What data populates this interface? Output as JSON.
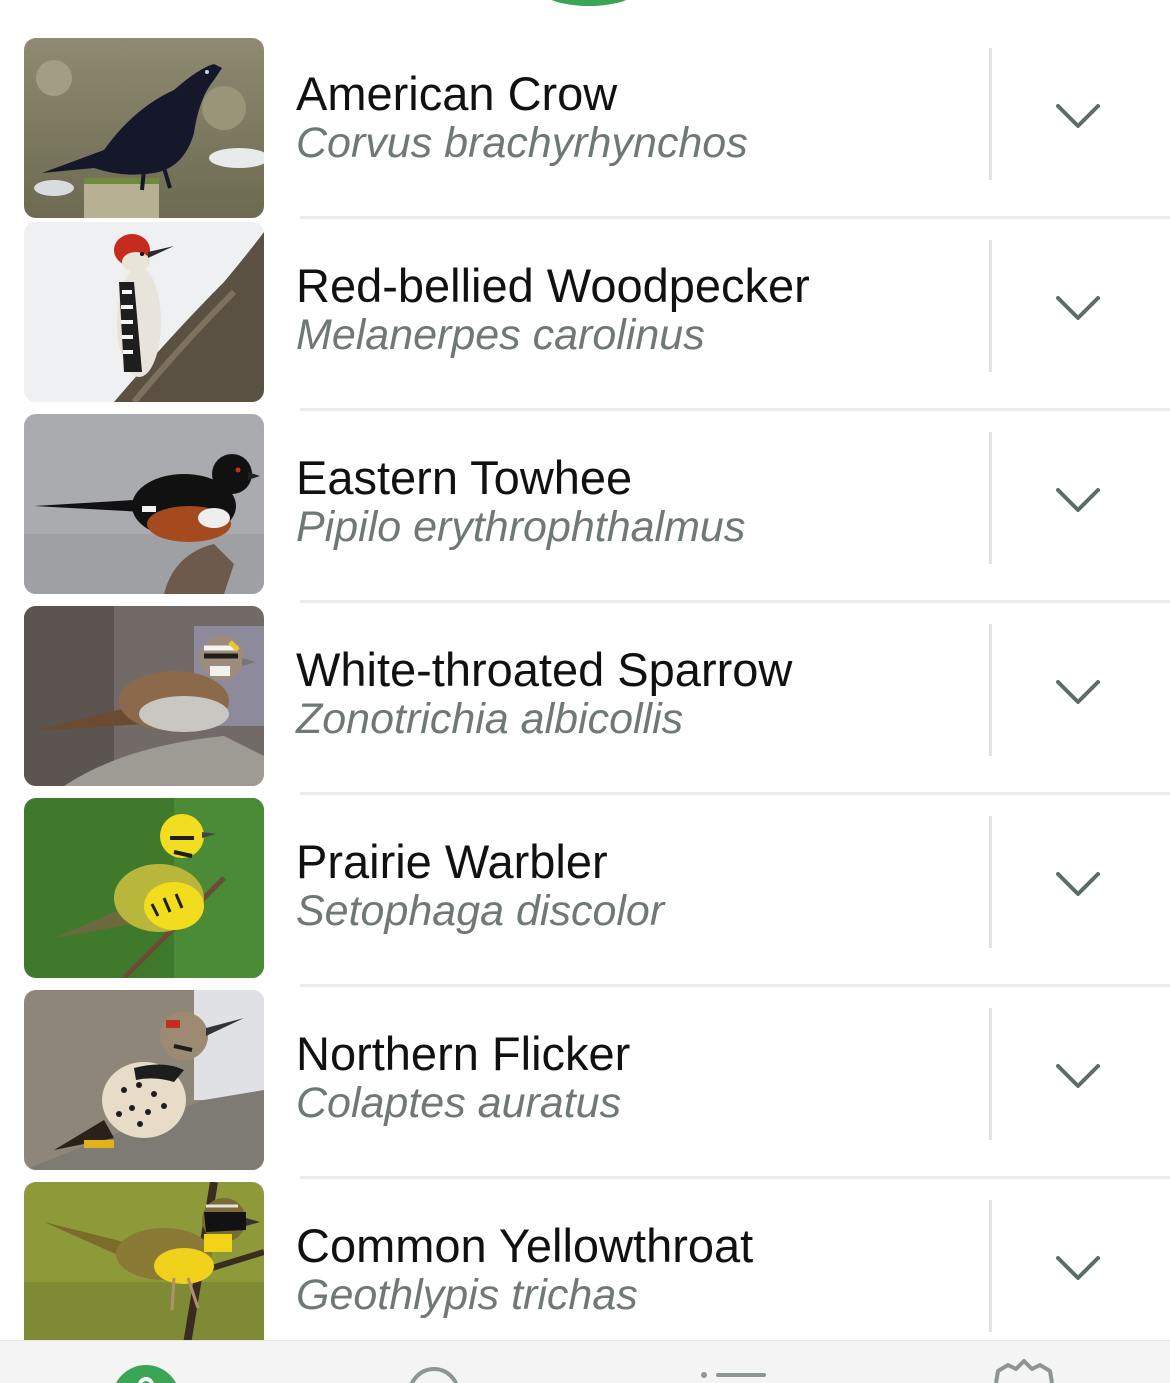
{
  "species": [
    {
      "common_name": "American Crow",
      "scientific_name": "Corvus brachyrhynchos",
      "photo": "american-crow-photo"
    },
    {
      "common_name": "Red-bellied Woodpecker",
      "scientific_name": "Melanerpes carolinus",
      "photo": "red-bellied-woodpecker-photo"
    },
    {
      "common_name": "Eastern Towhee",
      "scientific_name": "Pipilo erythrophthalmus",
      "photo": "eastern-towhee-photo"
    },
    {
      "common_name": "White-throated Sparrow",
      "scientific_name": "Zonotrichia albicollis",
      "photo": "white-throated-sparrow-photo"
    },
    {
      "common_name": "Prairie Warbler",
      "scientific_name": "Setophaga discolor",
      "photo": "prairie-warbler-photo"
    },
    {
      "common_name": "Northern Flicker",
      "scientific_name": "Colaptes auratus",
      "photo": "northern-flicker-photo"
    },
    {
      "common_name": "Common Yellowthroat",
      "scientific_name": "Geothlypis trichas",
      "photo": "common-yellowthroat-photo"
    }
  ],
  "tab_bar": {
    "tabs": [
      {
        "icon": "identify-icon",
        "active": true
      },
      {
        "icon": "search-icon",
        "active": false
      },
      {
        "icon": "list-icon",
        "active": false
      },
      {
        "icon": "gear-icon",
        "active": false
      }
    ]
  },
  "colors": {
    "accent_green": "#3aa655",
    "common_name_text": "#111111",
    "scientific_name_text": "#6f7875",
    "chevron": "#5f6b68"
  }
}
